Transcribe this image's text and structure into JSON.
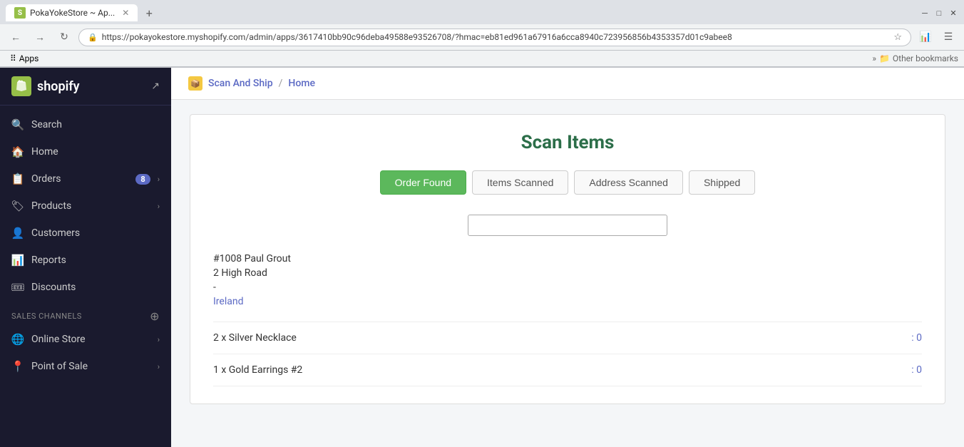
{
  "browser": {
    "tab_favicon": "S",
    "tab_title": "PokaYokeStore ~ Ap...",
    "url": "https://pokayokestore.myshopify.com/admin/apps/3617410bb90c96deba49588e93526708/?hmac=eb81ed961a67916a6cca8940c723956856b4353357d01c9abee8",
    "bookmarks_label": "Apps",
    "other_bookmarks": "Other bookmarks"
  },
  "sidebar": {
    "logo_text": "shopify",
    "items": [
      {
        "id": "search",
        "label": "Search",
        "icon": "🔍"
      },
      {
        "id": "home",
        "label": "Home",
        "icon": "🏠"
      },
      {
        "id": "orders",
        "label": "Orders",
        "icon": "📋",
        "badge": "8",
        "has_chevron": true
      },
      {
        "id": "products",
        "label": "Products",
        "icon": "🏷",
        "has_chevron": true
      },
      {
        "id": "customers",
        "label": "Customers",
        "icon": "👤"
      },
      {
        "id": "reports",
        "label": "Reports",
        "icon": "📊"
      },
      {
        "id": "discounts",
        "label": "Discounts",
        "icon": "🎟"
      }
    ],
    "sales_channels_label": "SALES CHANNELS",
    "sales_channels": [
      {
        "id": "online-store",
        "label": "Online Store",
        "icon": "🌐",
        "has_chevron": true
      },
      {
        "id": "point-of-sale",
        "label": "Point of Sale",
        "icon": "📍",
        "has_chevron": true
      }
    ]
  },
  "breadcrumb": {
    "app_name": "Scan And Ship",
    "separator": "/",
    "current": "Home"
  },
  "scan": {
    "title": "Scan Items",
    "steps": [
      {
        "id": "order-found",
        "label": "Order Found",
        "active": true
      },
      {
        "id": "items-scanned",
        "label": "Items Scanned",
        "active": false
      },
      {
        "id": "address-scanned",
        "label": "Address Scanned",
        "active": false
      },
      {
        "id": "shipped",
        "label": "Shipped",
        "active": false
      }
    ],
    "input_placeholder": "",
    "order": {
      "name": "#1008 Paul Grout",
      "address1": "2 High Road",
      "address2": "-",
      "country": "Ireland"
    },
    "items": [
      {
        "name": "2 x Silver Necklace",
        "count": ": 0"
      },
      {
        "name": "1 x Gold Earrings #2",
        "count": ": 0"
      }
    ]
  }
}
